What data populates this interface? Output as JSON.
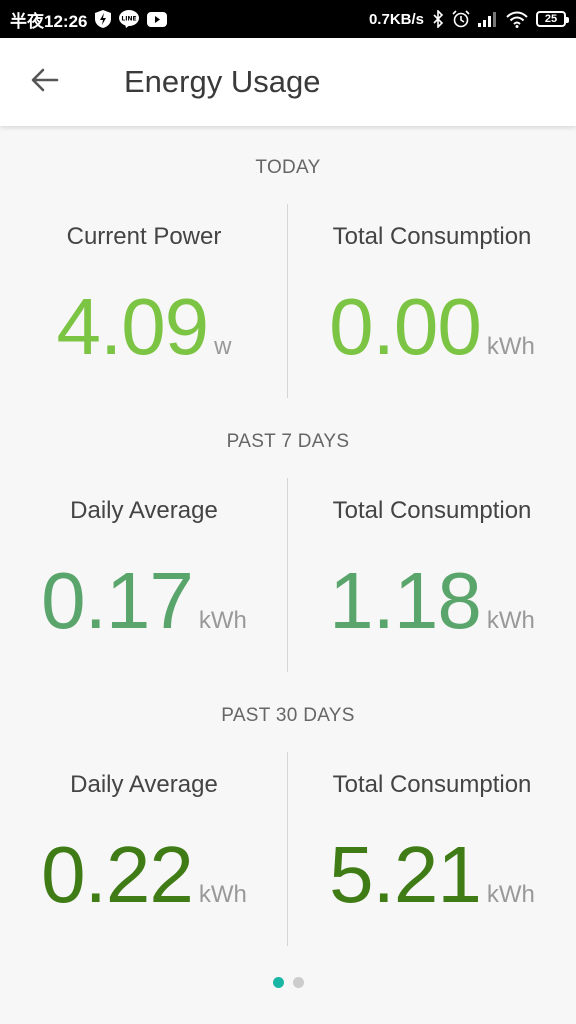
{
  "status_bar": {
    "time": "半夜12:26",
    "network_speed": "0.7KB/s",
    "battery": "25",
    "icons_left": [
      "bolt-shield-icon",
      "line-app-icon",
      "youtube-icon"
    ],
    "icons_right": [
      "bluetooth-icon",
      "alarm-icon",
      "signal-icon",
      "wifi-icon",
      "battery-icon"
    ]
  },
  "app_bar": {
    "title": "Energy Usage",
    "back_icon": "arrow-left-icon"
  },
  "sections": {
    "today": {
      "label": "TODAY",
      "left": {
        "label": "Current Power",
        "value": "4.09",
        "unit": "w"
      },
      "right": {
        "label": "Total Consumption",
        "value": "0.00",
        "unit": "kWh"
      }
    },
    "past7": {
      "label": "PAST 7 DAYS",
      "left": {
        "label": "Daily Average",
        "value": "0.17",
        "unit": "kWh"
      },
      "right": {
        "label": "Total Consumption",
        "value": "1.18",
        "unit": "kWh"
      }
    },
    "past30": {
      "label": "PAST 30 DAYS",
      "left": {
        "label": "Daily Average",
        "value": "0.22",
        "unit": "kWh"
      },
      "right": {
        "label": "Total Consumption",
        "value": "5.21",
        "unit": "kWh"
      }
    }
  },
  "pager": {
    "pages": 2,
    "active_index": 0
  },
  "colors": {
    "today_value": "#7cc443",
    "past7_value": "#5aa56c",
    "past30_value": "#3f7c16",
    "dot_active": "#19b5a5",
    "dot_inactive": "#cccccc"
  }
}
